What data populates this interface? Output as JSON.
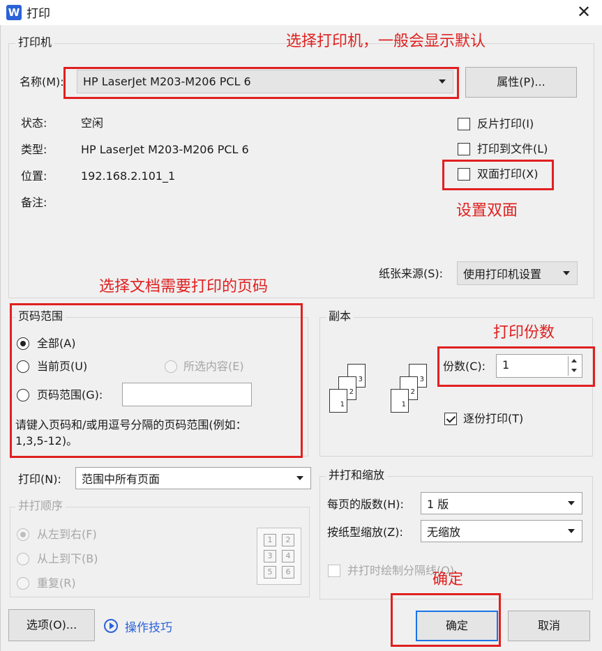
{
  "window": {
    "title": "打印",
    "app_logo": "W"
  },
  "printer_group": {
    "legend": "打印机",
    "name_label": "名称(M):",
    "selected_printer": "HP LaserJet M203-M206 PCL 6",
    "properties_button": "属性(P)...",
    "status_label": "状态:",
    "status_value": "空闲",
    "type_label": "类型:",
    "type_value": "HP LaserJet M203-M206 PCL 6",
    "location_label": "位置:",
    "location_value": "192.168.2.101_1",
    "comment_label": "备注:",
    "reverse_print": "反片打印(I)",
    "print_to_file": "打印到文件(L)",
    "duplex": "双面打印(X)",
    "paper_source_label": "纸张来源(S):",
    "paper_source_value": "使用打印机设置"
  },
  "page_range": {
    "legend": "页码范围",
    "all": "全部(A)",
    "current": "当前页(U)",
    "selection": "所选内容(E)",
    "range": "页码范围(G):",
    "range_value": "",
    "hint": "请键入页码和/或用逗号分隔的页码范围(例如：",
    "hint_example": "1,3,5-12)。"
  },
  "copies": {
    "legend": "副本",
    "count_label": "份数(C):",
    "count_value": "1",
    "collate": "逐份打印(T)",
    "stack1": [
      "1",
      "2",
      "3"
    ],
    "stack2": [
      "1",
      "2",
      "3"
    ]
  },
  "print_what": {
    "label": "打印(N):",
    "value": "范围中所有页面"
  },
  "print_order": {
    "legend": "并打顺序",
    "left_to_right": "从左到右(F)",
    "top_to_bottom": "从上到下(B)",
    "repeat": "重复(R)",
    "grid": [
      "1",
      "2",
      "3",
      "4",
      "5",
      "6"
    ]
  },
  "zoom": {
    "legend": "并打和缩放",
    "pages_per_sheet_label": "每页的版数(H):",
    "pages_per_sheet_value": "1 版",
    "scale_label": "按纸型缩放(Z):",
    "scale_value": "无缩放",
    "draw_borders": "并打时绘制分隔线(O)"
  },
  "footer": {
    "options_button": "选项(O)...",
    "tips_link": "操作技巧",
    "ok_button": "确定",
    "cancel_button": "取消"
  },
  "annotations": {
    "select_printer": "选择打印机，一般会显示默认",
    "set_duplex": "设置双面",
    "select_pages": "选择文档需要打印的页码",
    "copies_count": "打印份数",
    "confirm": "确定"
  },
  "colors": {
    "annotation": "#e02020",
    "accent": "#2b62d8",
    "dialog_bg": "#f0f0f0"
  }
}
